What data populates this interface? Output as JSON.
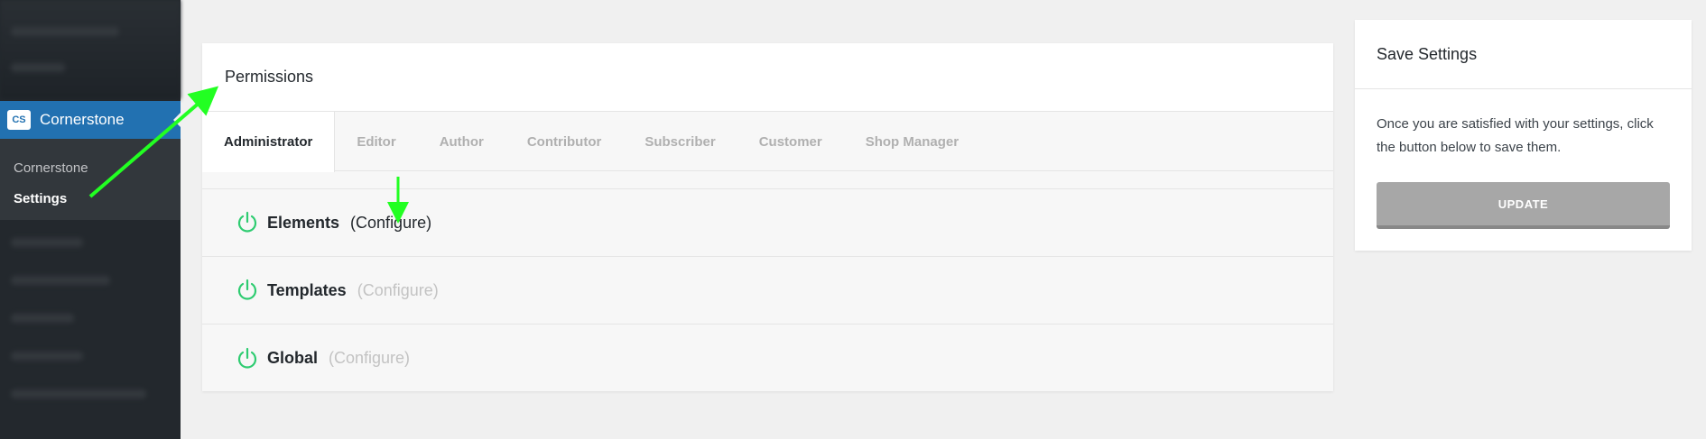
{
  "sidebar": {
    "menu_label": "Cornerstone",
    "logo_text": "CS",
    "submenu": [
      {
        "label": "Cornerstone"
      },
      {
        "label": "Settings"
      }
    ]
  },
  "panel": {
    "title": "Permissions",
    "tabs": [
      {
        "label": "Administrator"
      },
      {
        "label": "Editor"
      },
      {
        "label": "Author"
      },
      {
        "label": "Contributor"
      },
      {
        "label": "Subscriber"
      },
      {
        "label": "Customer"
      },
      {
        "label": "Shop Manager"
      }
    ],
    "rows": [
      {
        "name": "Elements",
        "configure": "(Configure)"
      },
      {
        "name": "Templates",
        "configure": "(Configure)"
      },
      {
        "name": "Global",
        "configure": "(Configure)"
      }
    ]
  },
  "save": {
    "title": "Save Settings",
    "description": "Once you are satisfied with your settings, click the button below to save them.",
    "button_label": "UPDATE"
  },
  "colors": {
    "accent": "#2271b1",
    "power_on": "#2ecc71",
    "annotation": "#22ff22"
  }
}
